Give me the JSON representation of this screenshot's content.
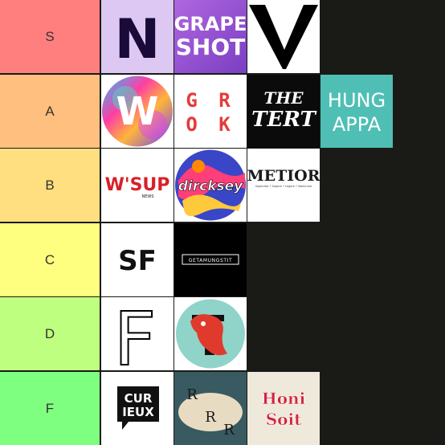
{
  "tiers": [
    {
      "label": "S",
      "color": "#ff7f7f"
    },
    {
      "label": "A",
      "color": "#ffbf7f"
    },
    {
      "label": "B",
      "color": "#ffdf7f"
    },
    {
      "label": "C",
      "color": "#ffff7f"
    },
    {
      "label": "D",
      "color": "#bfff7f"
    },
    {
      "label": "F",
      "color": "#7fff7f"
    }
  ],
  "logos": {
    "n": "N",
    "grapeshot_1": "GRAPE",
    "grapeshot_2": "SHOT",
    "v": "V",
    "w": "W",
    "grok_1": "G R",
    "grok_2": "O K",
    "tert_1": "THE",
    "tert_2": "TERT",
    "hung_1": "HUNG",
    "hung_2": "APPA",
    "wsup": "W'SUP",
    "wsup_sub": "NEWS",
    "dircksey": "dircksey",
    "metior": "METIOR",
    "metior_sub": "Sapientia • Sapere • Legere • Nominare",
    "sf": "SF",
    "getamungstit": "GETAMUNGSTIT",
    "f": "F",
    "curieux_1": "CUR",
    "curieux_2": "IEUX",
    "rrr_1": "R",
    "rrr_2": "R",
    "rrr_3": "R",
    "honi_1": "Honi",
    "honi_2": "Soit"
  },
  "colors": {
    "board_bg": "#1a1a17",
    "grapeshot_purple": "#9b4fd0",
    "hungappa_teal": "#4fbfb5",
    "tert_black": "#0b0b0b",
    "grok_red": "#e53b3b",
    "wsup_red": "#d82027"
  }
}
